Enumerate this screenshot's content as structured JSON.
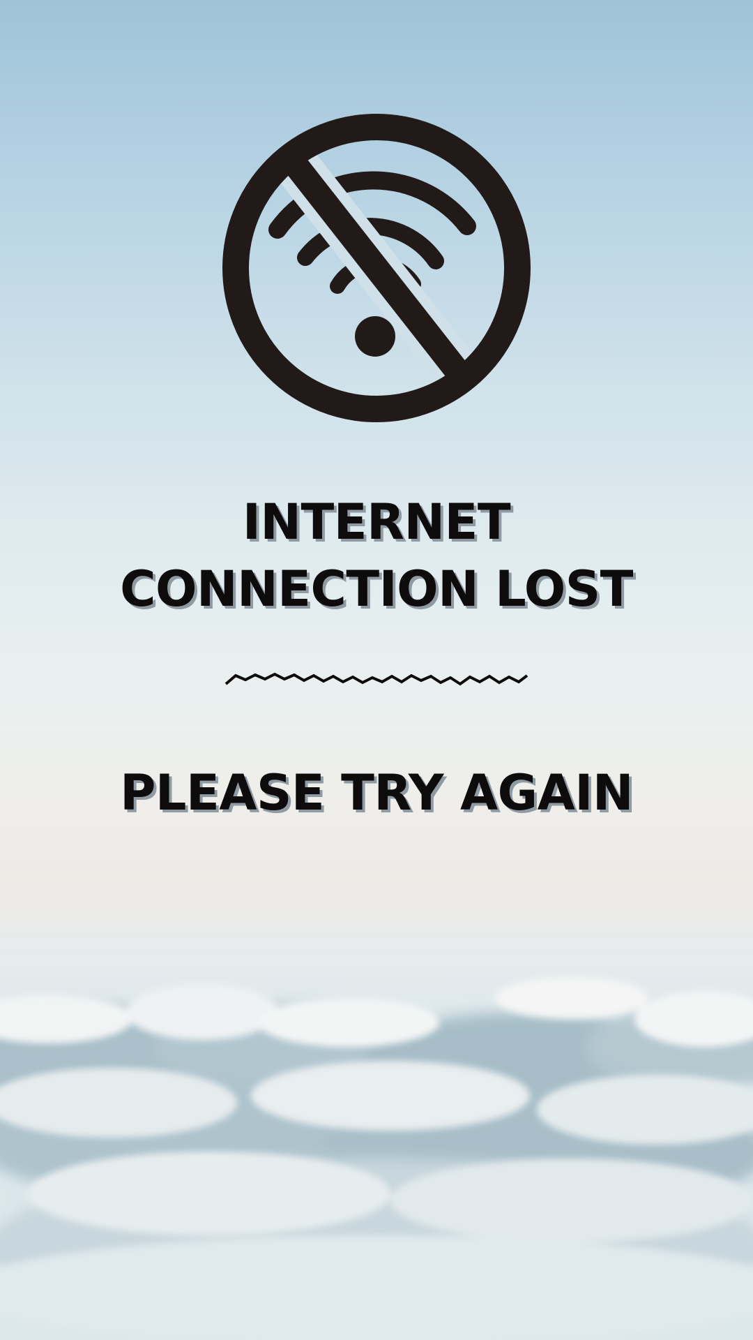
{
  "icon": {
    "name": "no-wifi-icon",
    "color": "#221a19"
  },
  "headline": {
    "line1": "INTERNET",
    "line2": "CONNECTION LOST"
  },
  "divider": {
    "style": "zigzag"
  },
  "message": {
    "text": "PLEASE TRY AGAIN"
  },
  "colors": {
    "text": "#0d0b0b",
    "text_shadow": "#8f9aa3",
    "sky_top": "#9fc3d8",
    "sky_mid": "#eaf0ef"
  }
}
